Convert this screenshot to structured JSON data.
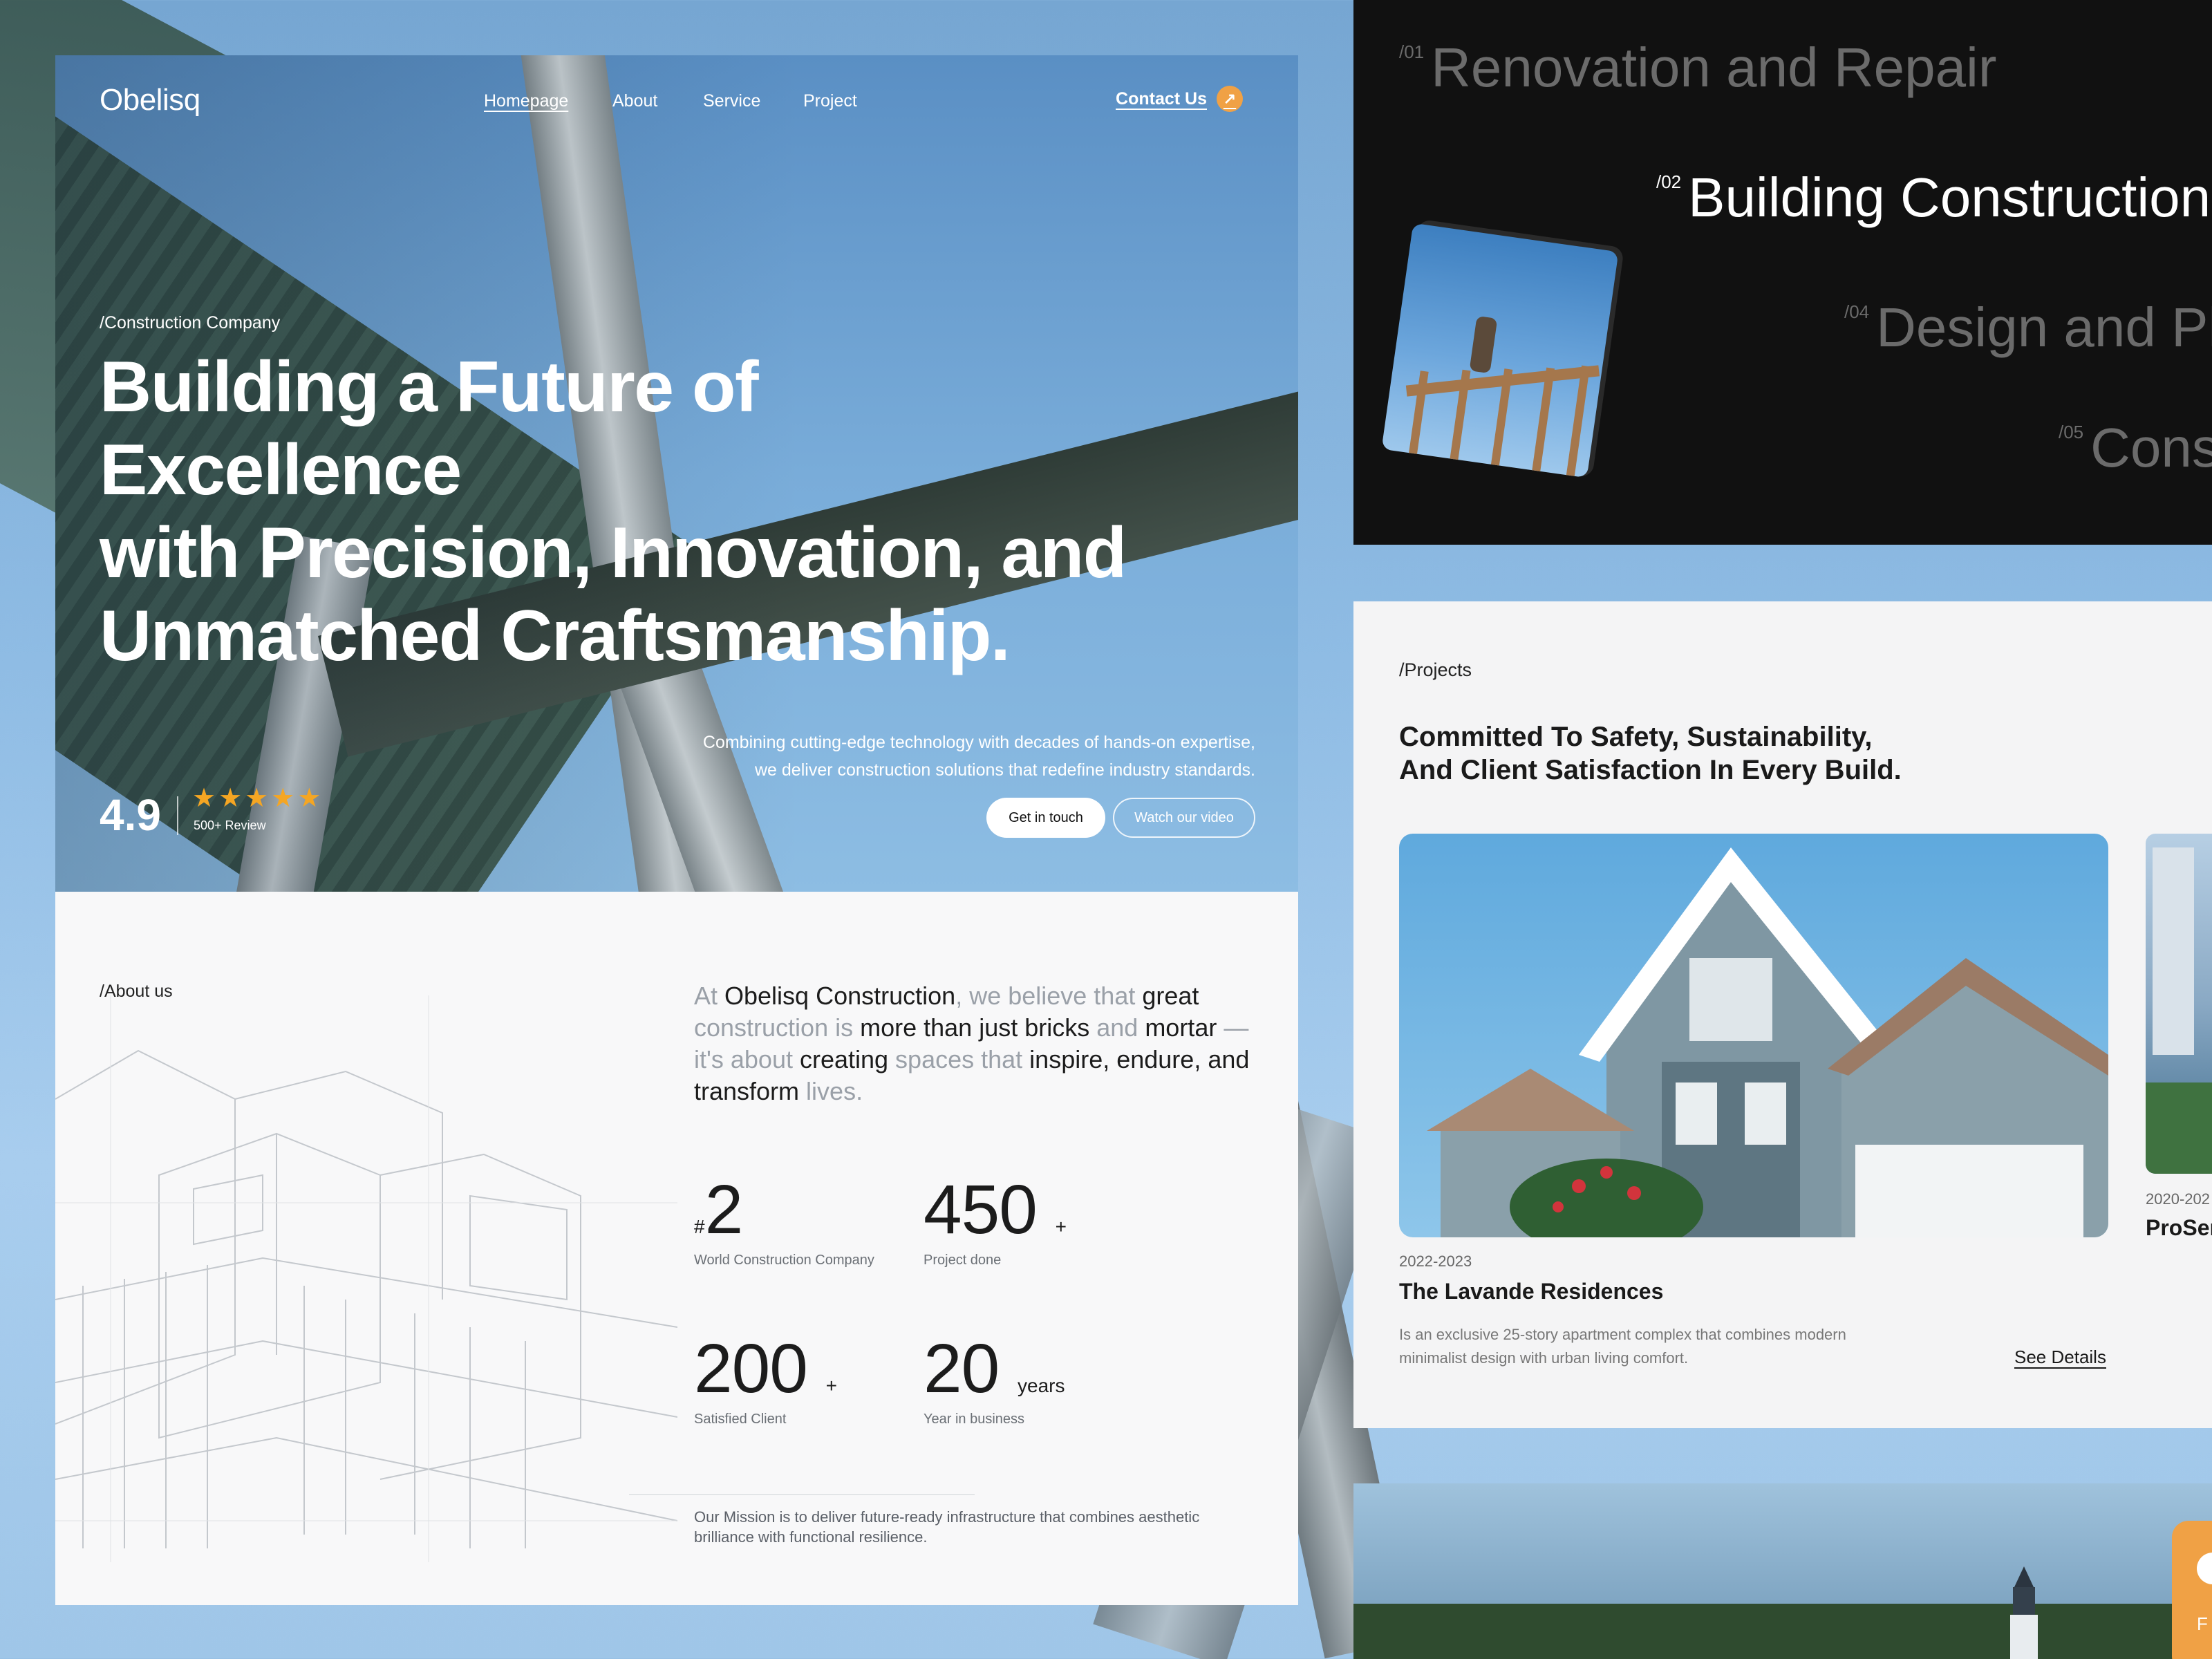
{
  "brand": {
    "name": "Obelisq",
    "accent": "#f0a145"
  },
  "nav": {
    "items": [
      {
        "label": "Homepage",
        "active": true
      },
      {
        "label": "About",
        "active": false
      },
      {
        "label": "Service",
        "active": false
      },
      {
        "label": "Project",
        "active": false
      }
    ],
    "contact_label": "Contact Us",
    "contact_icon": "arrow-up-right-icon"
  },
  "hero": {
    "eyebrow": "/Construction Company",
    "headline_lines": [
      "Building a Future of Excellence",
      "with Precision, Innovation, and",
      "Unmatched Craftsmanship."
    ],
    "subtitle_lines": [
      "Combining cutting-edge technology with decades of hands-on expertise,",
      "we deliver construction solutions that redefine industry standards."
    ],
    "primary_button": "Get in touch",
    "secondary_button": "Watch our video",
    "rating": "4.9",
    "rating_stars": 5,
    "reviews_label": "500+ Review"
  },
  "about": {
    "tag": "/About us",
    "quote_segments": [
      {
        "text": "At ",
        "muted": true
      },
      {
        "text": "Obelisq Construction",
        "muted": false
      },
      {
        "text": ", we believe that ",
        "muted": true
      },
      {
        "text": "great ",
        "muted": false
      },
      {
        "text": "construction is ",
        "muted": true
      },
      {
        "text": "more than just bricks ",
        "muted": false
      },
      {
        "text": "and ",
        "muted": true
      },
      {
        "text": "mortar ",
        "muted": false
      },
      {
        "text": "—it's about ",
        "muted": true
      },
      {
        "text": "creating ",
        "muted": false
      },
      {
        "text": "spaces that ",
        "muted": true
      },
      {
        "text": "inspire, endure, and transform ",
        "muted": false
      },
      {
        "text": "lives.",
        "muted": true
      }
    ],
    "stats": [
      {
        "prefix": "#",
        "value": "2",
        "suffix": "",
        "label": "World Construction Company"
      },
      {
        "prefix": "",
        "value": "450",
        "suffix": "+",
        "label": "Project done"
      },
      {
        "prefix": "",
        "value": "200",
        "suffix": "+",
        "label": "Satisfied Client"
      },
      {
        "prefix": "",
        "value": "20",
        "suffix": "years",
        "label": "Year in business"
      }
    ],
    "mission": "Our Mission is to deliver future-ready infrastructure that combines aesthetic brilliance with functional resilience."
  },
  "services": {
    "items": [
      {
        "num": "/01",
        "label": "Renovation and Repair",
        "active": false
      },
      {
        "num": "/02",
        "label": "Building Construction",
        "active": true
      },
      {
        "num": "/04",
        "label": "Design and Pl",
        "active": false
      },
      {
        "num": "/05",
        "label": "Cons",
        "active": false
      }
    ]
  },
  "projects": {
    "tag": "/Projects",
    "heading_lines": [
      "Committed To Safety, Sustainability,",
      "And Client Satisfaction In Every Build."
    ],
    "cards": [
      {
        "years": "2022-2023",
        "title": "The Lavande Residences",
        "description": "Is an exclusive 25-story apartment complex that combines modern minimalist design with urban living comfort.",
        "link": "See Details"
      },
      {
        "years": "2020-202",
        "title": "ProSer"
      }
    ]
  },
  "floating": {
    "label": "F"
  }
}
